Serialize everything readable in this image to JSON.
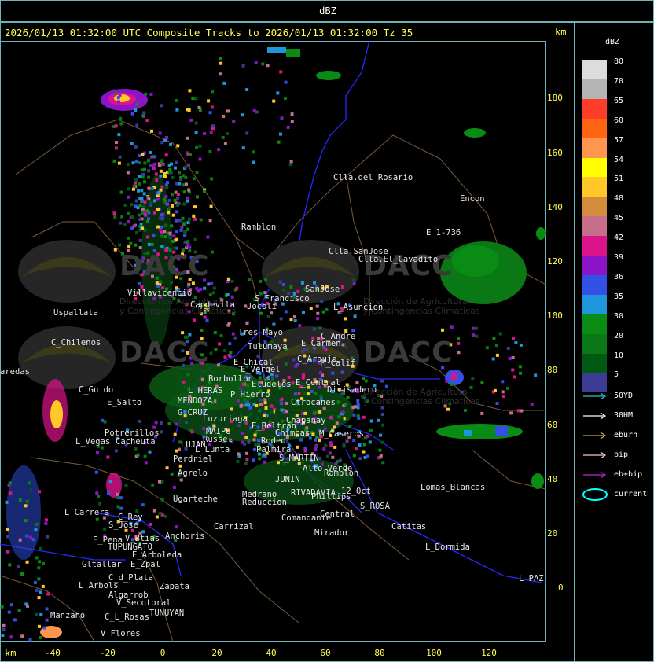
{
  "header": {
    "title": "dBZ"
  },
  "map": {
    "caption": "2026/01/13 01:32:00 UTC Composite Tracks to 2026/01/13 01:32:00 Tz 35",
    "km_top": "km",
    "km_bottom": "km",
    "y_ticks": [
      "180",
      "160",
      "140",
      "120",
      "100",
      "80",
      "60",
      "40",
      "20",
      "0"
    ],
    "x_ticks": [
      "-40",
      "-20",
      "0",
      "20",
      "40",
      "60",
      "80",
      "100",
      "120"
    ],
    "places": [
      "Clla.del_Rosario",
      "Encon",
      "E_1-736",
      "Ramblon",
      "Clla.SanJose",
      "Clla.El_Cavadito",
      "Villavicencio",
      "Capdevila",
      "S_Francisco",
      "SanJose",
      "L_Asuncion",
      "Uspallata",
      "Jocoli",
      "Tres_Mayo",
      "C_Andre",
      "Tulumaya",
      "E_Carmen",
      "C_Chilenos",
      "C_Araujo",
      "M_Calif",
      "E_Chical",
      "E_Vergel",
      "Borbollon",
      "Eludeles",
      "E_Central",
      "Divisadero",
      "C_Guido",
      "L_HERAS",
      "P_Hierro",
      "Ctrocanes",
      "E_Salto",
      "MENDOZA",
      "G_CRUZ",
      "Luzuriaga",
      "Chapanay",
      "E_Beltran",
      "Chimbas",
      "M_Caseros",
      "Potrerillos",
      "L_Vegas",
      "Cacheuta",
      "MAIPU",
      "Russel",
      "Rodeo",
      "Palmira",
      "L_Lunta",
      "LUJAN",
      "Perdriel",
      "S_MARTIN",
      "Alto_Verde",
      "Ramblon",
      "Agrelo",
      "JUNIN",
      "RIVADAVIA",
      "Phillips",
      "12_Oct",
      "Lomas_Blancas",
      "Ugarteche",
      "L_Carrera",
      "C_Rey",
      "Reduccion",
      "Medrano",
      "S_ROSA",
      "S_Jose",
      "Carrizal",
      "Comandante",
      "Catitas",
      "Central",
      "E_Pena",
      "TUPUNGATO",
      "V_Btias",
      "Anchoris",
      "Mirador",
      "L_Dormida",
      "E_Zpal",
      "E_Arboleda",
      "Gltallar",
      "C_d_Plata",
      "L_Arbols",
      "Zapata",
      "Algarrob",
      "V_Secotoral",
      "TUNUYAN",
      "L_PAZ",
      "Manzano",
      "C_L_Rosas",
      "V_Flores",
      "aredas"
    ],
    "watermark": {
      "brand": "DACC",
      "line1": "Dirección de Agricultura",
      "line2": "y Contingencias Climáticas"
    }
  },
  "legend": {
    "title": "dBZ",
    "scale": [
      {
        "label": "80",
        "color": "#dcdcdc"
      },
      {
        "label": "70",
        "color": "#b4b4b4"
      },
      {
        "label": "65",
        "color": "#ff3c28"
      },
      {
        "label": "60",
        "color": "#ff6414"
      },
      {
        "label": "57",
        "color": "#ff9650"
      },
      {
        "label": "54",
        "color": "#ffff00"
      },
      {
        "label": "51",
        "color": "#ffc828"
      },
      {
        "label": "48",
        "color": "#d28c3c"
      },
      {
        "label": "45",
        "color": "#c86e8c"
      },
      {
        "label": "42",
        "color": "#dc148c"
      },
      {
        "label": "39",
        "color": "#8c14c8"
      },
      {
        "label": "36",
        "color": "#3250e6"
      },
      {
        "label": "35",
        "color": "#1e96dc"
      },
      {
        "label": "30",
        "color": "#0a8c14"
      },
      {
        "label": "20",
        "color": "#0a7814"
      },
      {
        "label": "10",
        "color": "#005a14"
      },
      {
        "label": "5",
        "color": "#3c3c96"
      }
    ],
    "tracks": [
      {
        "label": "50YD",
        "color": "#28c8c8"
      },
      {
        "label": "30HM",
        "color": "#ffffff"
      },
      {
        "label": "eburn",
        "color": "#d2a050"
      },
      {
        "label": "bip",
        "color": "#ffc8c8"
      },
      {
        "label": "eb+bip",
        "color": "#c828c8"
      },
      {
        "label": "current",
        "color": "#00ffff"
      }
    ]
  }
}
